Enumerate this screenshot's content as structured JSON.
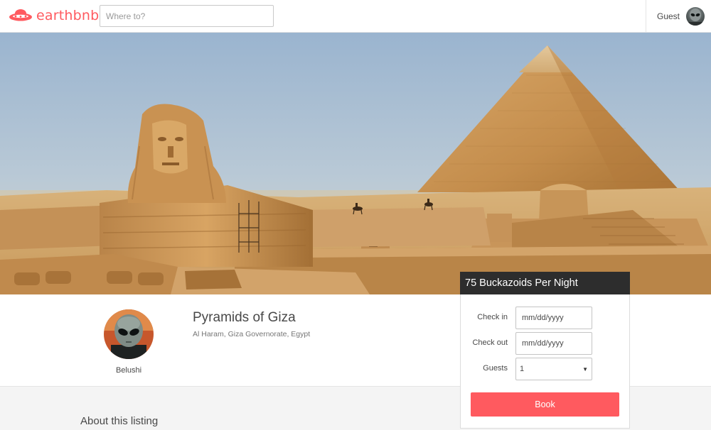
{
  "header": {
    "brand_name": "earthbnb",
    "brand_icon": "ufo-icon",
    "search_placeholder": "Where to?",
    "user_label": "Guest",
    "user_avatar_icon": "alien-avatar"
  },
  "hero": {
    "image": "pyramids-of-giza-photo"
  },
  "listing": {
    "title": "Pyramids of Giza",
    "location": "Al Haram, Giza Governorate, Egypt",
    "host_name": "Belushi",
    "host_avatar": "alien-avatar"
  },
  "booking": {
    "price_text": "75 Buckazoids Per Night",
    "check_in_label": "Check in",
    "check_in_placeholder": "mm/dd/yyyy",
    "check_out_label": "Check out",
    "check_out_placeholder": "mm/dd/yyyy",
    "guests_label": "Guests",
    "guests_value": "1",
    "book_label": "Book"
  },
  "about": {
    "heading": "About this listing"
  },
  "colors": {
    "brand": "#ff5a5f",
    "price_bar": "#2d2d2d",
    "text": "#484848"
  }
}
